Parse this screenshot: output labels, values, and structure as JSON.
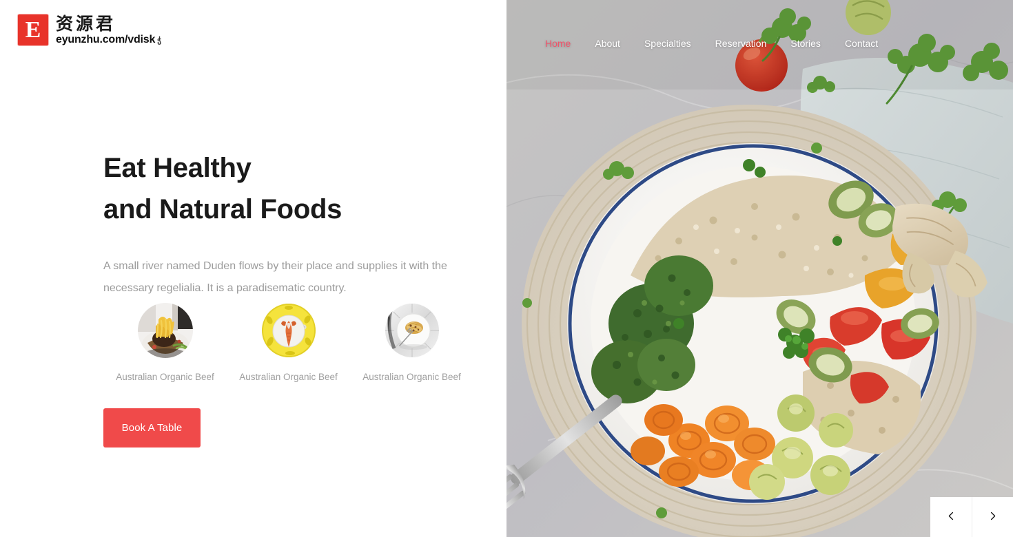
{
  "brand": {
    "logo_letter": "E",
    "logo_cn": "资源君",
    "logo_url": "eyunzhu.com/vdisk",
    "logo_url_suffix": "ჭ",
    "accent_red": "#e8332a"
  },
  "nav": {
    "items": [
      {
        "label": "Home",
        "active": true
      },
      {
        "label": "About",
        "active": false
      },
      {
        "label": "Specialties",
        "active": false
      },
      {
        "label": "Reservation",
        "active": false
      },
      {
        "label": "Stories",
        "active": false
      },
      {
        "label": "Contact",
        "active": false
      }
    ],
    "active_color": "#f0546b",
    "color": "#ffffff"
  },
  "hero": {
    "title_line1": "Eat Healthy",
    "title_line2": "and Natural Foods",
    "paragraph": "A small river named Duden flows by their place and supplies it with the necessary regelialia. It is a paradisematic country.",
    "cta_label": "Book A Table",
    "cta_color": "#f04a4a",
    "title_color": "#1a1a1a",
    "paragraph_color": "#9b9b9b"
  },
  "dishes": [
    {
      "label": "Australian Organic Beef",
      "image": "beef-noodles-thumbnail"
    },
    {
      "label": "Australian Organic Beef",
      "image": "lobster-yellow-plate-thumbnail"
    },
    {
      "label": "Australian Organic Beef",
      "image": "pasta-white-plate-thumbnail"
    }
  ],
  "carousel": {
    "prev_icon": "chevron-left-icon",
    "next_icon": "chevron-right-icon"
  },
  "hero_photo": {
    "alt": "Quinoa vegetable bowl with broccoli, carrots, brussels sprouts, peppers and zucchini on a blue-rimmed plate, with fork, ginger, tomato and parsley on marble"
  }
}
